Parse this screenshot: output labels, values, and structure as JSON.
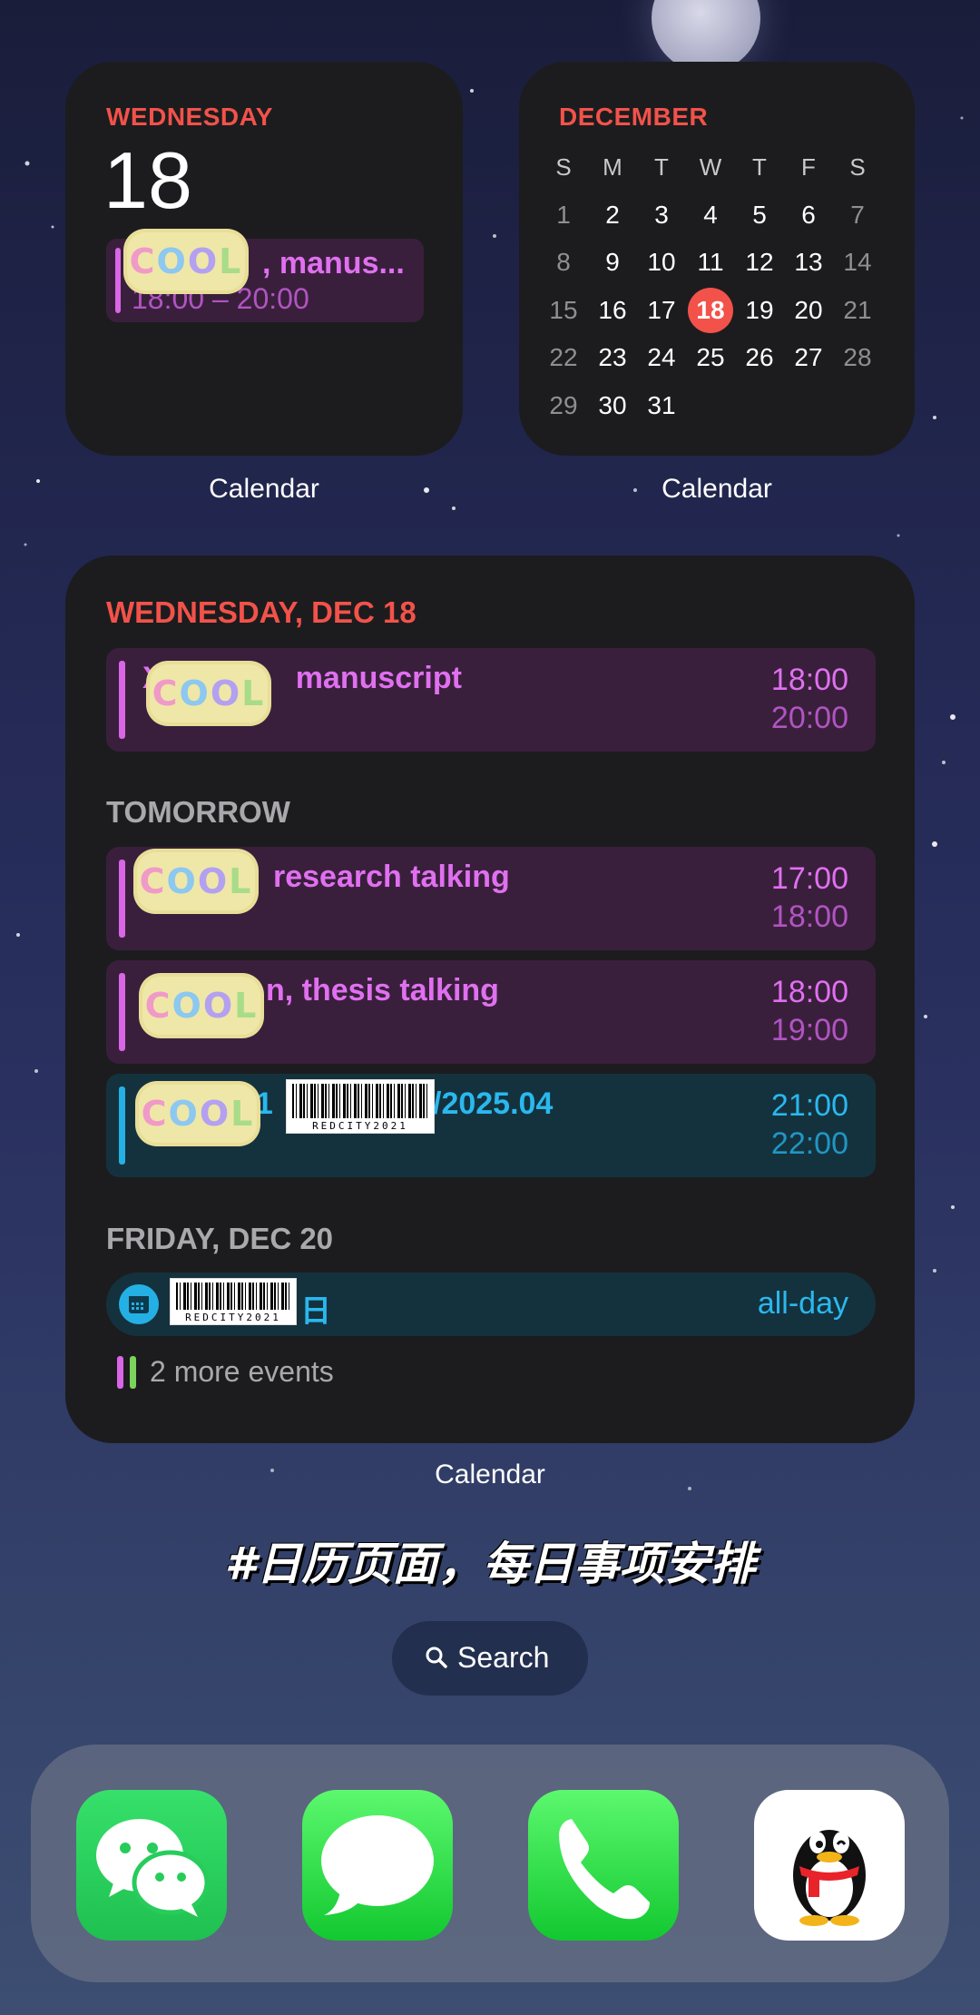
{
  "widgets": {
    "day": {
      "weekday": "WEDNESDAY",
      "date": "18",
      "event_title": ", manus...",
      "event_time": "18:00 – 20:00",
      "caption": "Calendar"
    },
    "month": {
      "month": "DECEMBER",
      "caption": "Calendar",
      "headers": [
        "S",
        "M",
        "T",
        "W",
        "T",
        "F",
        "S"
      ],
      "weeks": [
        [
          "1",
          "2",
          "3",
          "4",
          "5",
          "6",
          "7"
        ],
        [
          "8",
          "9",
          "10",
          "11",
          "12",
          "13",
          "14"
        ],
        [
          "15",
          "16",
          "17",
          "18",
          "19",
          "20",
          "21"
        ],
        [
          "22",
          "23",
          "24",
          "25",
          "26",
          "27",
          "28"
        ],
        [
          "29",
          "30",
          "31",
          "",
          "",
          "",
          ""
        ]
      ],
      "today": "18"
    },
    "list": {
      "caption": "Calendar",
      "today_header": "WEDNESDAY, DEC 18",
      "tomorrow_header": "TOMORROW",
      "friday_header": "FRIDAY, DEC 20",
      "events": [
        {
          "title": "manuscript",
          "prefix": "X",
          "start": "18:00",
          "end": "20:00",
          "color": "pink"
        },
        {
          "title": "research talking",
          "prefix": "",
          "start": "17:00",
          "end": "18:00",
          "color": "pink"
        },
        {
          "title": "n, thesis talking",
          "prefix": "",
          "start": "18:00",
          "end": "19:00",
          "color": "pink"
        },
        {
          "title": "/2025.04",
          "prefix": "31",
          "start": "21:00",
          "end": "22:00",
          "color": "blue"
        }
      ],
      "allday_event": {
        "title": "日",
        "right": "all-day"
      },
      "more_events": "2 more events"
    }
  },
  "stickers": {
    "cool_text": "COOL",
    "barcode_text": "REDCITY2021"
  },
  "caption_cn": "#日历页面，每日事项安排",
  "search": {
    "label": "Search"
  },
  "dock": {
    "apps": [
      "WeChat",
      "Messages",
      "Phone",
      "QQ"
    ]
  },
  "colors": {
    "accent_red": "#f2524a",
    "event_pink": "#e070f0",
    "event_blue": "#2ab8ee",
    "widget_bg": "#1c1c1e"
  }
}
